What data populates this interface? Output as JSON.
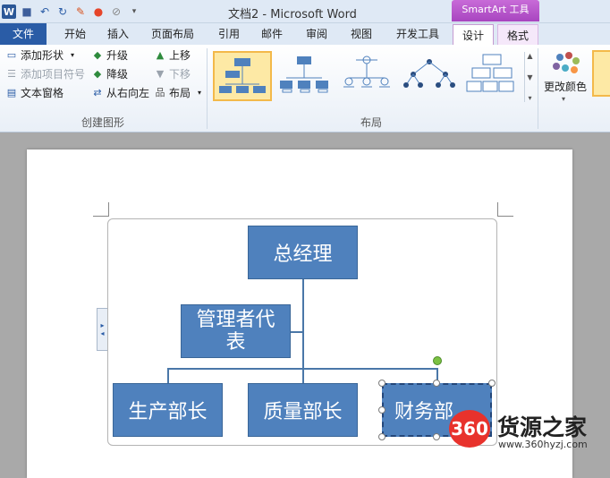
{
  "window": {
    "title": "文档2 - Microsoft Word",
    "contextual_tab_group": "SmartArt 工具"
  },
  "quick_access": {
    "icons": [
      "word-logo-icon",
      "save-icon",
      "undo-icon",
      "redo-icon",
      "color-icon",
      "customize-icon"
    ]
  },
  "tabs": [
    "文件",
    "开始",
    "插入",
    "页面布局",
    "引用",
    "邮件",
    "审阅",
    "视图",
    "开发工具",
    "设计",
    "格式"
  ],
  "ribbon": {
    "create_graphic": {
      "label": "创建图形",
      "add_shape": "添加形状",
      "add_bullet": "添加项目符号",
      "text_pane": "文本窗格",
      "promote": "升级",
      "demote": "降级",
      "right_to_left": "从右向左",
      "move_up": "上移",
      "move_down": "下移",
      "layout": "布局"
    },
    "layouts": {
      "label": "布局"
    },
    "change_colors": "更改颜色"
  },
  "accent_colors": {
    "node_fill": "#4f81bd",
    "file_tab": "#2a5ca6",
    "smartart_tools": "#b455c8"
  },
  "smartart": {
    "top": "总经理",
    "assistant": "管理者代表",
    "children": [
      "生产部长",
      "质量部长",
      "财务部"
    ]
  },
  "watermark": {
    "logo": "360",
    "name": "货源之家",
    "url": "www.360hyzj.com"
  }
}
